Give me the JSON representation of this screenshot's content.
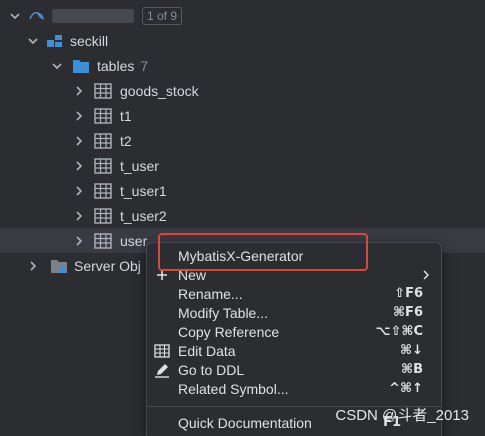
{
  "tree": {
    "connection": {
      "icon": "mysql-icon",
      "badge": "1 of 9"
    },
    "schema": {
      "label": "seckill",
      "icon": "schema-icon"
    },
    "tables_folder": {
      "label": "tables",
      "count": "7",
      "icon": "folder-icon"
    },
    "tables": [
      {
        "label": "goods_stock"
      },
      {
        "label": "t1"
      },
      {
        "label": "t2"
      },
      {
        "label": "t_user"
      },
      {
        "label": "t_user1"
      },
      {
        "label": "t_user2"
      },
      {
        "label": "user"
      }
    ],
    "server_objects": {
      "label": "Server Obj"
    }
  },
  "context_menu": {
    "items": [
      {
        "label": "MybatisX-Generator",
        "shortcut": "",
        "icon": ""
      },
      {
        "label": "New",
        "shortcut": "",
        "icon": "plus-icon",
        "submenu": true
      },
      {
        "label": "Rename...",
        "shortcut": "⇧F6",
        "icon": ""
      },
      {
        "label": "Modify Table...",
        "shortcut": "⌘F6",
        "icon": ""
      },
      {
        "label": "Copy Reference",
        "shortcut": "⌥⇧⌘C",
        "icon": ""
      },
      {
        "label": "Edit Data",
        "shortcut": "⌘↓",
        "icon": "table-grid-icon"
      },
      {
        "label": "Go to DDL",
        "shortcut": "⌘B",
        "icon": "pencil-icon"
      },
      {
        "label": "Related Symbol...",
        "shortcut": "^⌘↑",
        "icon": ""
      },
      {
        "label": "Quick Documentation",
        "shortcut": "F1",
        "icon": ""
      }
    ]
  },
  "watermark": "CSDN @斗者_2013",
  "colors": {
    "background": "#2b2d30",
    "folder_blue": "#3d8fd6",
    "highlight_red": "#e0453a"
  }
}
